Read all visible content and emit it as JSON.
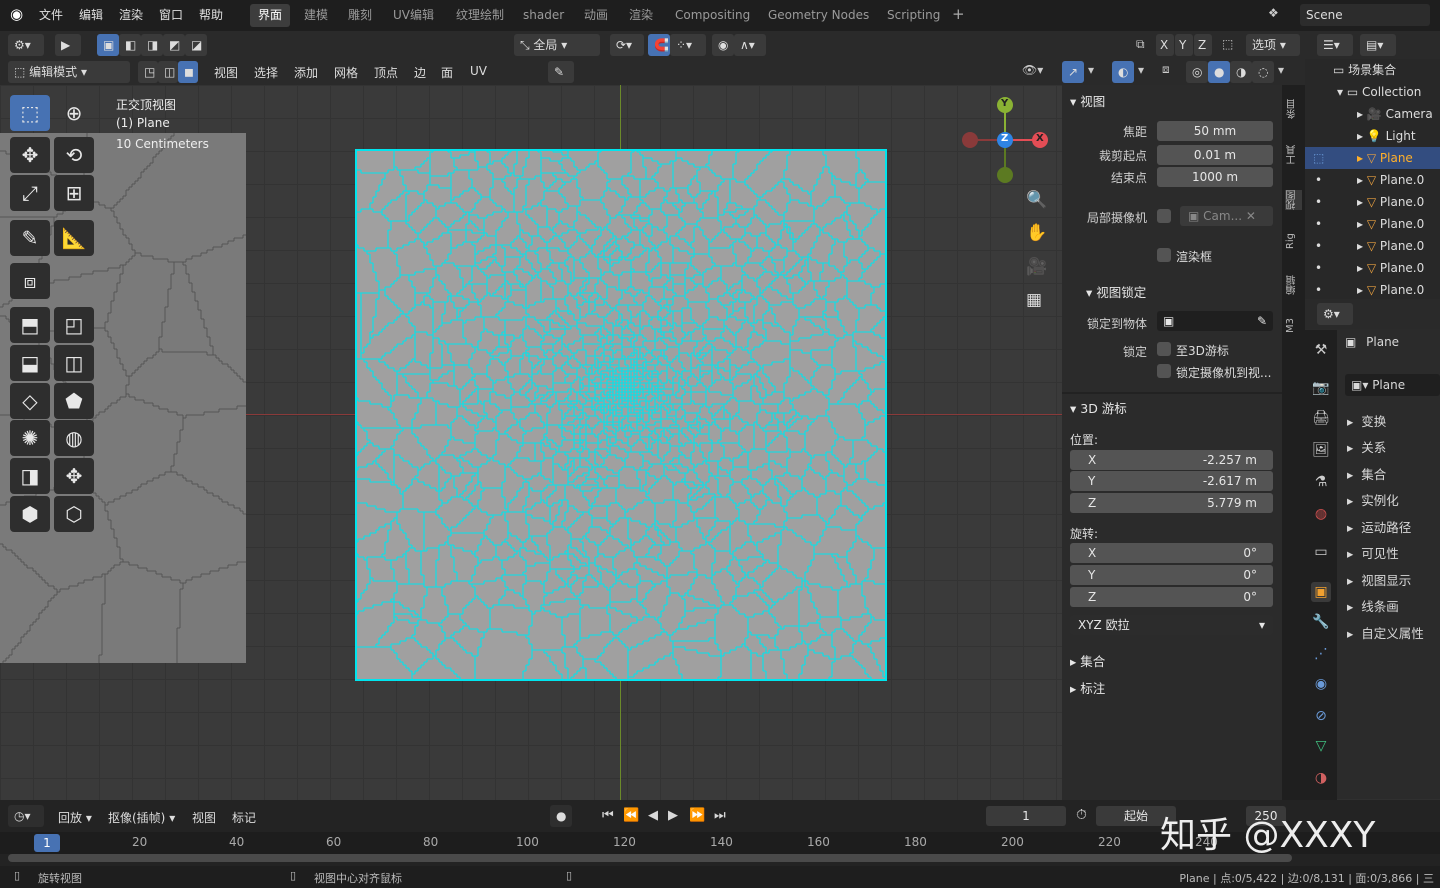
{
  "topbar": {
    "menus": [
      "文件",
      "编辑",
      "渲染",
      "窗口",
      "帮助"
    ],
    "workspaces": [
      "界面",
      "建模",
      "雕刻",
      "UV编辑",
      "纹理绘制",
      "shader",
      "动画",
      "渲染",
      "Compositing",
      "Geometry Nodes",
      "Scripting"
    ],
    "active_workspace": "界面",
    "add_tab": "+",
    "scene": "Scene"
  },
  "header": {
    "mode": "编辑模式",
    "menus": [
      "视图",
      "选择",
      "添加",
      "网格",
      "顶点",
      "边",
      "面",
      "UV"
    ],
    "transform_orientation": "全局",
    "options": "选项",
    "axes": [
      "X",
      "Y",
      "Z"
    ]
  },
  "viewport": {
    "view_name": "正交顶视图",
    "object": "(1) Plane",
    "scale": "10 Centimeters",
    "mesh_color": "#00e5ee",
    "plane_color": "#a0a0a0",
    "gizmo": {
      "y": "Y",
      "z": "Z",
      "x": "X"
    }
  },
  "npanel": {
    "view_section": "视图",
    "focal_label": "焦距",
    "focal_value": "50 mm",
    "clip_start_label": "裁剪起点",
    "clip_start_value": "0.01 m",
    "clip_end_label": "结束点",
    "clip_end_value": "1000 m",
    "local_camera_label": "局部摄像机",
    "local_camera_value": "Cam...",
    "render_border": "渲染框",
    "view_lock": "视图锁定",
    "lock_object_label": "锁定到物体",
    "lock_label": "锁定",
    "lock_3d_cursor": "至3D游标",
    "lock_camera": "锁定摄像机到视...",
    "cursor_section": "3D 游标",
    "location_label": "位置:",
    "loc_x": "-2.257 m",
    "loc_y": "-2.617 m",
    "loc_z": "5.779 m",
    "rotation_label": "旋转:",
    "rot_x": "0°",
    "rot_y": "0°",
    "rot_z": "0°",
    "rot_mode": "XYZ 欧拉",
    "collection_section": "集合",
    "annotation_section": "标注",
    "axis_x": "X",
    "axis_y": "Y",
    "axis_z": "Z"
  },
  "vtabs": [
    "条目",
    "工具",
    "视图",
    "Rig",
    "编辑",
    "M3"
  ],
  "outliner": {
    "root": "场景集合",
    "collection": "Collection",
    "items": [
      "Camera",
      "Light",
      "Plane",
      "Plane.0",
      "Plane.0",
      "Plane.0",
      "Plane.0",
      "Plane.0",
      "Plane.0"
    ]
  },
  "properties": {
    "object_name": "Plane",
    "data_name": "Plane",
    "sections": [
      "变换",
      "关系",
      "集合",
      "实例化",
      "运动路径",
      "可见性",
      "视图显示",
      "线条画",
      "自定义属性"
    ]
  },
  "timeline": {
    "playback": "回放",
    "keying": "抠像(插帧)",
    "view": "视图",
    "marker": "标记",
    "current_frame": "1",
    "start_label": "起始",
    "end_frame": "250",
    "ticks": [
      "1",
      "20",
      "40",
      "60",
      "80",
      "100",
      "120",
      "140",
      "160",
      "180",
      "200",
      "220",
      "240"
    ],
    "watermark": "知乎 @XXXY"
  },
  "statusbar": {
    "rotate_view": "旋转视图",
    "center_view": "视图中心对齐鼠标",
    "stats": "Plane | 点:0/5,422 | 边:0/8,131 | 面:0/3,866 | 三"
  }
}
